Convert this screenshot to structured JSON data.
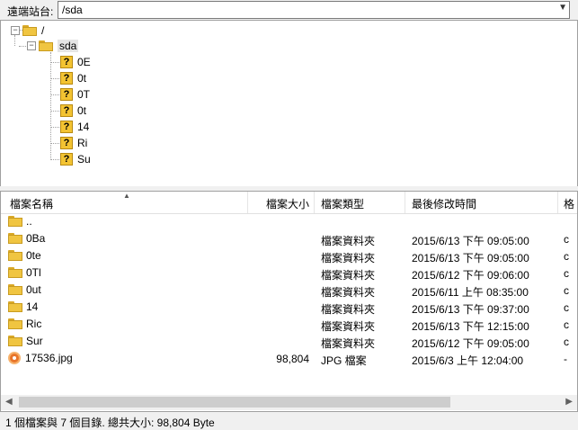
{
  "address": {
    "label": "遠端站台:",
    "value": "/sda"
  },
  "tree": {
    "root_label": "/",
    "child_label": "sda",
    "leaf_labels": [
      "0E",
      "0t",
      "0T",
      "0t",
      "14",
      "Ri",
      "Su"
    ]
  },
  "list": {
    "headers": {
      "name": "檔案名稱",
      "size": "檔案大小",
      "type": "檔案類型",
      "modified": "最後修改時間",
      "more": "格"
    },
    "rows": [
      {
        "name": "..",
        "size": "",
        "type": "",
        "modified": "",
        "more": "",
        "icon": "folder-icon"
      },
      {
        "name": "0Ba",
        "size": "",
        "type": "檔案資料夾",
        "modified": "2015/6/13 下午 09:05:00",
        "more": "c",
        "icon": "folder-icon"
      },
      {
        "name": "0te",
        "size": "",
        "type": "檔案資料夾",
        "modified": "2015/6/13 下午 09:05:00",
        "more": "c",
        "icon": "folder-icon"
      },
      {
        "name": "0Tl",
        "size": "",
        "type": "檔案資料夾",
        "modified": "2015/6/12 下午 09:06:00",
        "more": "c",
        "icon": "folder-icon"
      },
      {
        "name": "0ut",
        "size": "",
        "type": "檔案資料夾",
        "modified": "2015/6/11 上午 08:35:00",
        "more": "c",
        "icon": "folder-icon"
      },
      {
        "name": "14",
        "size": "",
        "type": "檔案資料夾",
        "modified": "2015/6/13 下午 09:37:00",
        "more": "c",
        "icon": "folder-icon"
      },
      {
        "name": "Ric",
        "size": "",
        "type": "檔案資料夾",
        "modified": "2015/6/13 下午 12:15:00",
        "more": "c",
        "icon": "folder-icon"
      },
      {
        "name": "Sur",
        "size": "",
        "type": "檔案資料夾",
        "modified": "2015/6/12 下午 09:05:00",
        "more": "c",
        "icon": "folder-icon"
      },
      {
        "name": "17536.jpg",
        "size": "98,804",
        "type": "JPG 檔案",
        "modified": "2015/6/3 上午 12:04:00",
        "more": "-",
        "icon": "jpg-file-icon"
      }
    ]
  },
  "status": {
    "text": "1 個檔案與 7 個目錄. 總共大小: 98,804 Byte"
  }
}
